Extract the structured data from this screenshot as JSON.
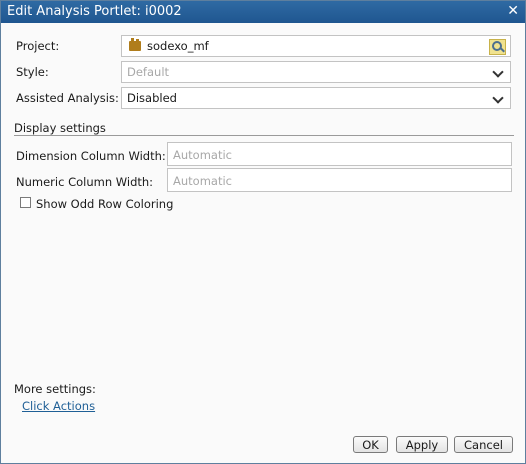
{
  "dialog": {
    "title": "Edit Analysis Portlet: i0002",
    "close_icon": "close-icon"
  },
  "form": {
    "project_label": "Project:",
    "project_value": "sodexo_mf",
    "project_icon": "project-icon",
    "browse_icon": "search-folder-icon",
    "style_label": "Style:",
    "style_value": "Default",
    "assisted_label": "Assisted Analysis:",
    "assisted_value": "Disabled"
  },
  "display": {
    "heading": "Display settings",
    "dim_label": "Dimension Column Width:",
    "dim_placeholder": "Automatic",
    "num_label": "Numeric Column Width:",
    "num_placeholder": "Automatic",
    "odd_row_label": "Show Odd Row Coloring",
    "odd_row_checked": false
  },
  "more": {
    "heading": "More settings:",
    "click_actions": "Click Actions"
  },
  "buttons": {
    "ok": "OK",
    "apply": "Apply",
    "cancel": "Cancel"
  },
  "colors": {
    "titlebar": "#2563a0",
    "link": "#1f5f96"
  }
}
